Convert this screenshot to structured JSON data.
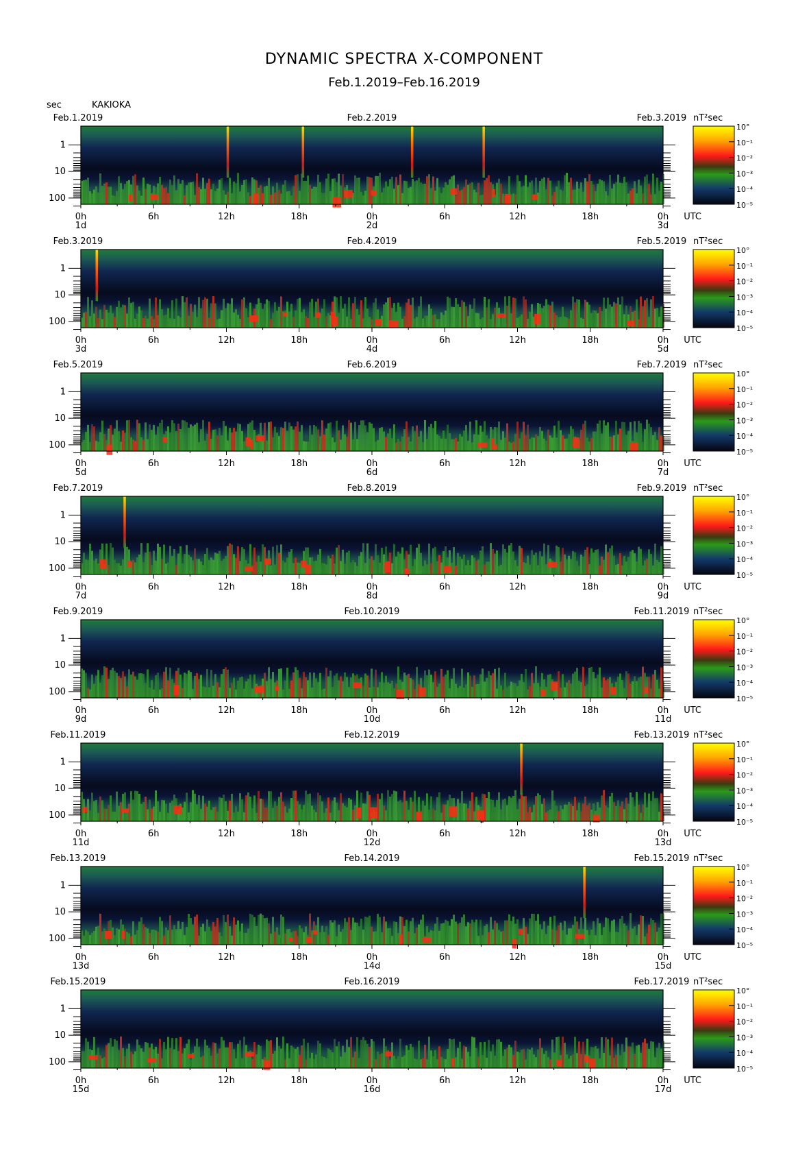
{
  "page": {
    "title": "DYNAMIC SPECTRA X-COMPONENT",
    "subtitle": "Feb.1.2019–Feb.16.2019",
    "y_unit": "sec",
    "station": "KAKIOKA",
    "colorbar_unit": "nT²sec",
    "utc_label": "UTC"
  },
  "chart_data": {
    "type": "heatmap",
    "title": "DYNAMIC SPECTRA X-COMPONENT",
    "subtitle": "Feb.1.2019–Feb.16.2019",
    "ylabel": "sec",
    "y_scale": "log",
    "y_range_sec": [
      1,
      300
    ],
    "y_ticks": [
      "1",
      "10",
      "100"
    ],
    "x_ticks": [
      "0h",
      "6h",
      "12h",
      "18h",
      "0h",
      "6h",
      "12h",
      "18h",
      "0h"
    ],
    "x_range_hours": [
      0,
      48
    ],
    "colorbar": {
      "unit": "nT²sec",
      "labels": [
        "10°",
        "10⁻¹",
        "10⁻²",
        "10⁻³",
        "10⁻⁴",
        "10⁻⁵"
      ],
      "colors": [
        "#ffff00",
        "#ff8800",
        "#ff1a1a",
        "#2a9a1a",
        "#1a4a9a",
        "#05050f"
      ]
    },
    "panels": [
      {
        "start_date": "Feb.1.2019",
        "mid_date": "Feb.2.2019",
        "end_date": "Feb.3.2019",
        "day_start": "1d",
        "day_mid": "2d",
        "day_end": "3d",
        "spikes_hours": [
          12.1,
          18.3,
          27.3,
          33.2
        ]
      },
      {
        "start_date": "Feb.3.2019",
        "mid_date": "Feb.4.2019",
        "end_date": "Feb.5.2019",
        "day_start": "3d",
        "day_mid": "4d",
        "day_end": "5d",
        "spikes_hours": [
          1.3
        ]
      },
      {
        "start_date": "Feb.5.2019",
        "mid_date": "Feb.6.2019",
        "end_date": "Feb.7.2019",
        "day_start": "5d",
        "day_mid": "6d",
        "day_end": "7d",
        "spikes_hours": []
      },
      {
        "start_date": "Feb.7.2019",
        "mid_date": "Feb.8.2019",
        "end_date": "Feb.9.2019",
        "day_start": "7d",
        "day_mid": "8d",
        "day_end": "9d",
        "spikes_hours": [
          3.6
        ]
      },
      {
        "start_date": "Feb.9.2019",
        "mid_date": "Feb.10.2019",
        "end_date": "Feb.11.2019",
        "day_start": "9d",
        "day_mid": "10d",
        "day_end": "11d",
        "spikes_hours": []
      },
      {
        "start_date": "Feb.11.2019",
        "mid_date": "Feb.12.2019",
        "end_date": "Feb.13.2019",
        "day_start": "11d",
        "day_mid": "12d",
        "day_end": "13d",
        "spikes_hours": [
          36.3
        ]
      },
      {
        "start_date": "Feb.13.2019",
        "mid_date": "Feb.14.2019",
        "end_date": "Feb.15.2019",
        "day_start": "13d",
        "day_mid": "14d",
        "day_end": "15d",
        "spikes_hours": [
          41.5
        ]
      },
      {
        "start_date": "Feb.15.2019",
        "mid_date": "Feb.16.2019",
        "end_date": "Feb.17.2019",
        "day_start": "15d",
        "day_mid": "16d",
        "day_end": "17d",
        "spikes_hours": []
      }
    ]
  }
}
